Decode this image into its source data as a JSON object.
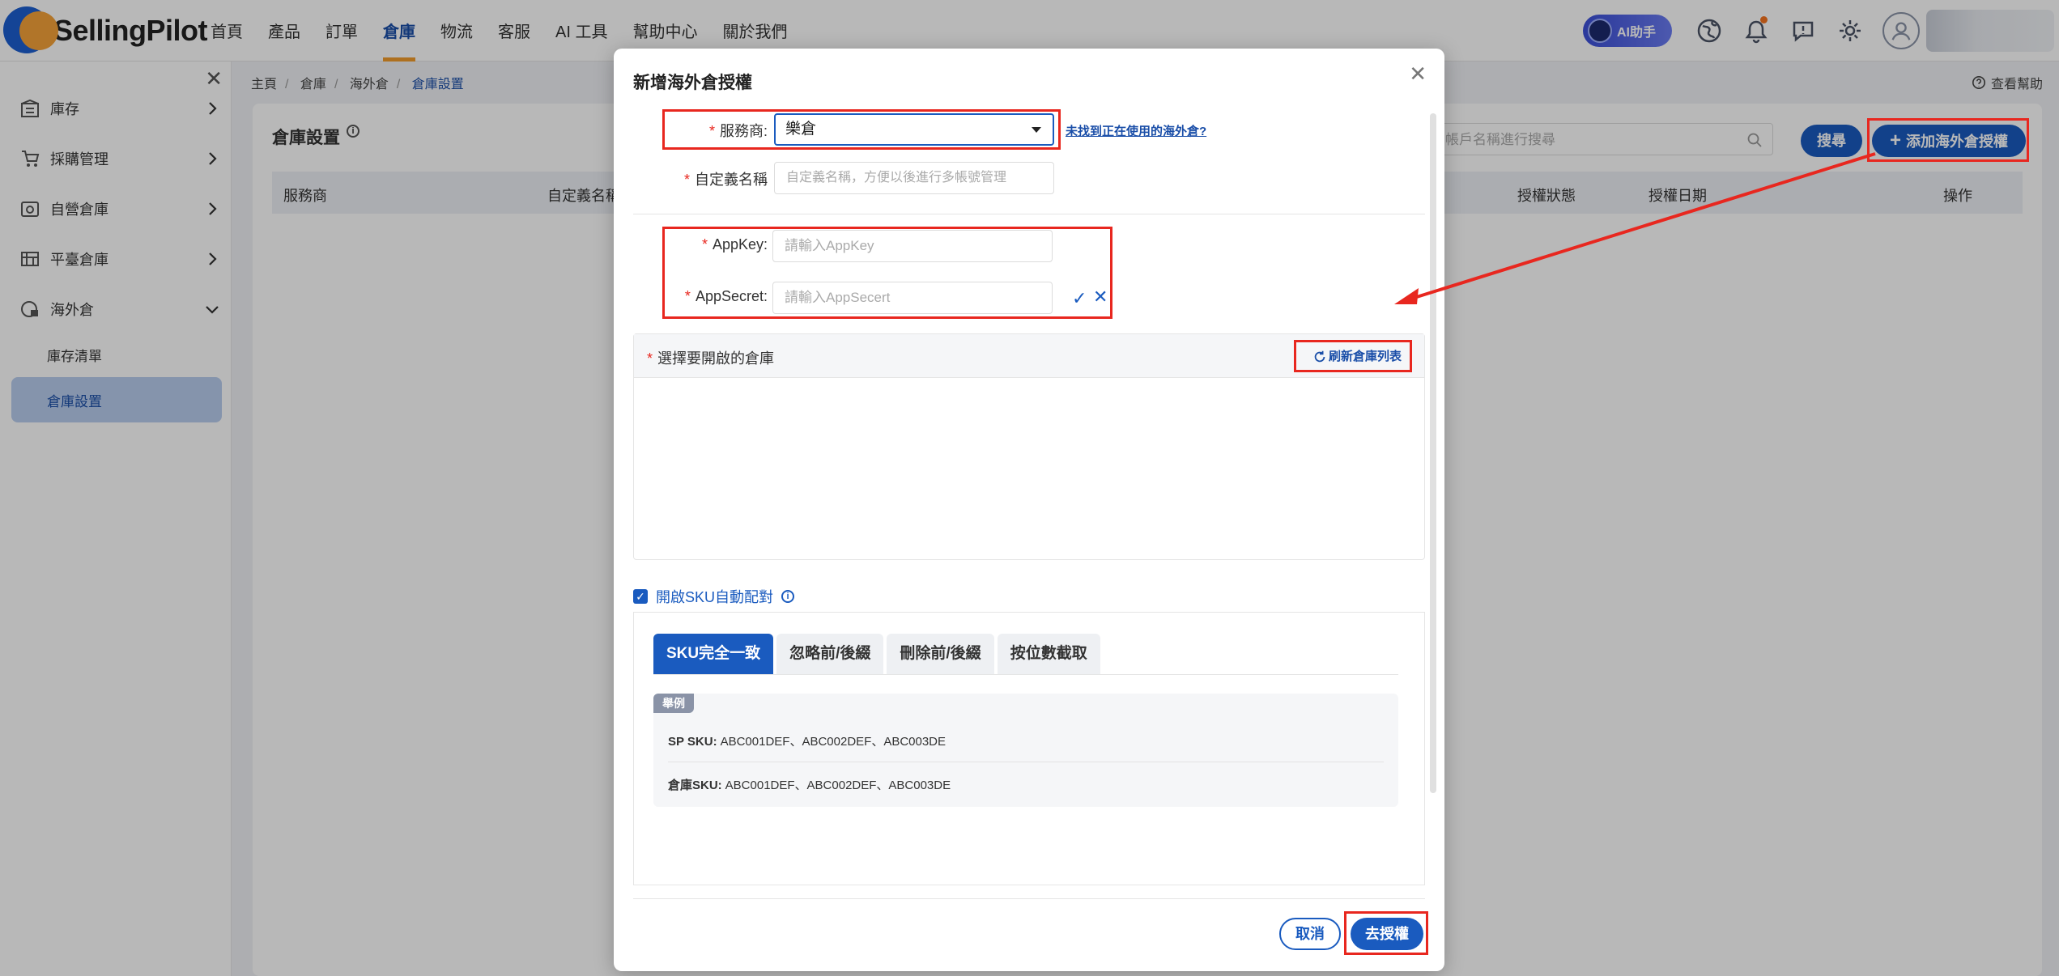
{
  "app": {
    "logo_text": "SellingPilot",
    "ai_label": "AI助手"
  },
  "nav": {
    "items": [
      "首頁",
      "產品",
      "訂單",
      "倉庫",
      "物流",
      "客服",
      "AI 工具",
      "幫助中心",
      "關於我們"
    ],
    "active": "倉庫"
  },
  "sidebar": {
    "items": [
      {
        "label": "庫存"
      },
      {
        "label": "採購管理"
      },
      {
        "label": "自營倉庫"
      },
      {
        "label": "平臺倉庫"
      },
      {
        "label": "海外倉"
      }
    ],
    "sub_items": [
      "庫存清單",
      "倉庫設置"
    ],
    "active_sub": "倉庫設置"
  },
  "breadcrumb": [
    "主頁",
    "倉庫",
    "海外倉",
    "倉庫設置"
  ],
  "help": {
    "label": "查看幫助"
  },
  "page": {
    "title": "倉庫設置",
    "search_placeholder": "帳戶名稱進行搜尋",
    "search_button": "搜尋",
    "add_button": "添加海外倉授權",
    "table_headers": [
      "服務商",
      "自定義名稱",
      "授權狀態",
      "授權日期",
      "操作"
    ]
  },
  "modal": {
    "title": "新增海外倉授權",
    "provider_label": "服務商:",
    "provider_value": "樂倉",
    "not_found_link": "未找到正在使用的海外倉?",
    "custom_name_label": "自定義名稱",
    "custom_name_placeholder": "自定義名稱，方便以後進行多帳號管理",
    "appkey_label": "AppKey:",
    "appkey_placeholder": "請輸入AppKey",
    "appsecret_label": "AppSecret:",
    "appsecret_placeholder": "請輸入AppSecert",
    "warehouse_label": "選擇要開啟的倉庫",
    "refresh_label": "刷新倉庫列表",
    "sku_checkbox_label": "開啟SKU自動配對",
    "sku_tabs": [
      "SKU完全一致",
      "忽略前/後綴",
      "刪除前/後綴",
      "按位數截取"
    ],
    "example_tag": "舉例",
    "example_lines": [
      {
        "key": "SP SKU:",
        "value": "ABC001DEF、ABC002DEF、ABC003DE"
      },
      {
        "key": "倉庫SKU:",
        "value": "ABC001DEF、ABC002DEF、ABC003DE"
      }
    ],
    "cancel_button": "取消",
    "authorize_button": "去授權"
  },
  "colors": {
    "primary": "#1a5bbf",
    "accent": "#f19b2c",
    "annotation": "#e8271f"
  }
}
